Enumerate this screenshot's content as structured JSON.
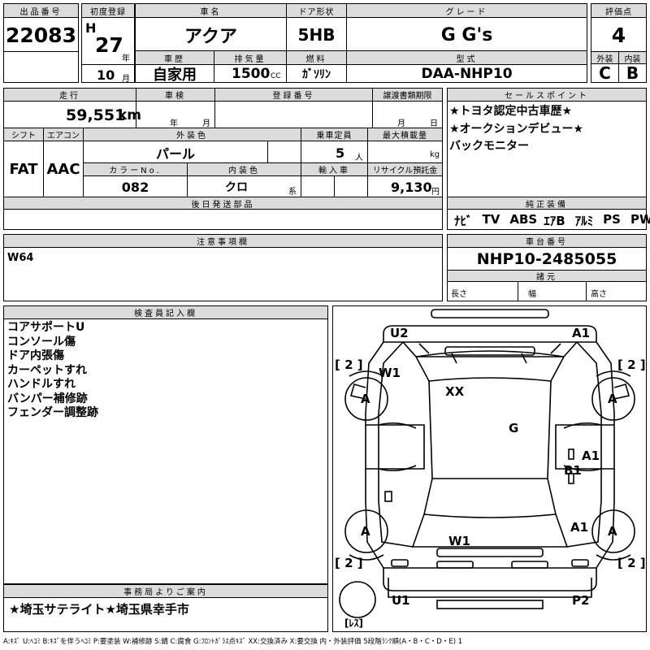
{
  "lot": {
    "label": "出品番号",
    "value": "22083"
  },
  "first_reg": {
    "label": "初度登録",
    "era": "H",
    "year": "27",
    "year_unit": "年",
    "month": "10",
    "month_unit": "月"
  },
  "car_name": {
    "label": "車名",
    "value": "アクア"
  },
  "door": {
    "label": "ドア形状",
    "value": "5HB"
  },
  "grade": {
    "label": "グレード",
    "value": "G G's"
  },
  "score": {
    "label": "評価点",
    "value": "4"
  },
  "history": {
    "label": "車歴",
    "value": "自家用"
  },
  "displacement": {
    "label": "排気量",
    "value": "1500",
    "unit": "CC"
  },
  "fuel": {
    "label": "燃料",
    "value": "ｶﾞｿﾘﾝ"
  },
  "model": {
    "label": "型式",
    "value": "DAA-NHP10"
  },
  "exterior": {
    "label": "外装",
    "value": "C"
  },
  "interior": {
    "label": "内装",
    "value": "B"
  },
  "mileage": {
    "label": "走行",
    "value": "59,551",
    "unit": "km"
  },
  "inspection": {
    "label": "車検",
    "year_unit": "年",
    "month_unit": "月"
  },
  "reg_no": {
    "label": "登録番号"
  },
  "transfer": {
    "label": "譲渡書類期限",
    "month_unit": "月",
    "day_unit": "日"
  },
  "sales_point": {
    "label": "セールスポイント",
    "lines": [
      "★トヨタ認定中古車歴★",
      "★オークションデビュー★",
      "バックモニター"
    ]
  },
  "shift": {
    "label": "シフト",
    "value": "FAT"
  },
  "aircon": {
    "label": "エアコン",
    "value": "AAC"
  },
  "color": {
    "label": "外装色",
    "value": "パール"
  },
  "capacity": {
    "label": "乗車定員",
    "value": "5",
    "unit": "人"
  },
  "max_load": {
    "label": "最大積載量",
    "unit": "kg"
  },
  "color_no": {
    "label": "カラーNo.",
    "value": "082"
  },
  "interior_color": {
    "label": "内装色",
    "value": "クロ",
    "suffix": "系"
  },
  "import": {
    "label": "輸入車"
  },
  "recycle": {
    "label": "リサイクル預託金",
    "value": "9,130",
    "unit": "円"
  },
  "later_parts": {
    "label": "後日発送部品"
  },
  "equipment": {
    "label": "純正装備",
    "items": [
      "ﾅﾋﾞ",
      "TV",
      "ABS",
      "ｴｱB",
      "ｱﾙﾐ",
      "PS",
      "PW"
    ]
  },
  "notes": {
    "label": "注意事項欄",
    "value": "W64"
  },
  "chassis": {
    "label": "車台番号",
    "value": "NHP10-2485055"
  },
  "specs": {
    "label": "諸元",
    "length": "長さ",
    "width": "幅",
    "height": "高さ"
  },
  "inspector": {
    "label": "検査員記入欄",
    "lines": [
      "コアサポートU",
      "コンソール傷",
      "ドア内張傷",
      "カーペットすれ",
      "ハンドルすれ",
      "バンパー補修跡",
      "フェンダー調整跡"
    ]
  },
  "office": {
    "label": "事務局よりご案内",
    "value": "★埼玉サテライト★埼玉県幸手市"
  },
  "diagram": {
    "labels": {
      "u2": "U2",
      "a1_top": "A1",
      "w1_top": "W1",
      "xx": "XX",
      "g": "G",
      "a1_mid": "A1",
      "b1": "B1",
      "a1_low": "A1",
      "w1_low": "W1",
      "u1": "U1",
      "p2": "P2"
    },
    "tires": [
      "A",
      "A",
      "A",
      "A"
    ],
    "brackets": [
      "[ 2 ]",
      "[ 2 ]",
      "[ 2 ]",
      "[ 2 ]"
    ],
    "spare": "[ﾚｽ]"
  },
  "legend": "A:ｷｽﾞ U:ﾍｺﾐ B:ｷｽﾞを伴うﾍｺﾐ P:要塗装 W:補修跡 S:錆 C:腐食 G:ﾌﾛﾝﾄｶﾞﾗｽ点ｷｽﾞ XX:交換済み X:要交換 内・外装評価 5段階ﾗﾝｸ順(A・B・C・D・E) 1"
}
